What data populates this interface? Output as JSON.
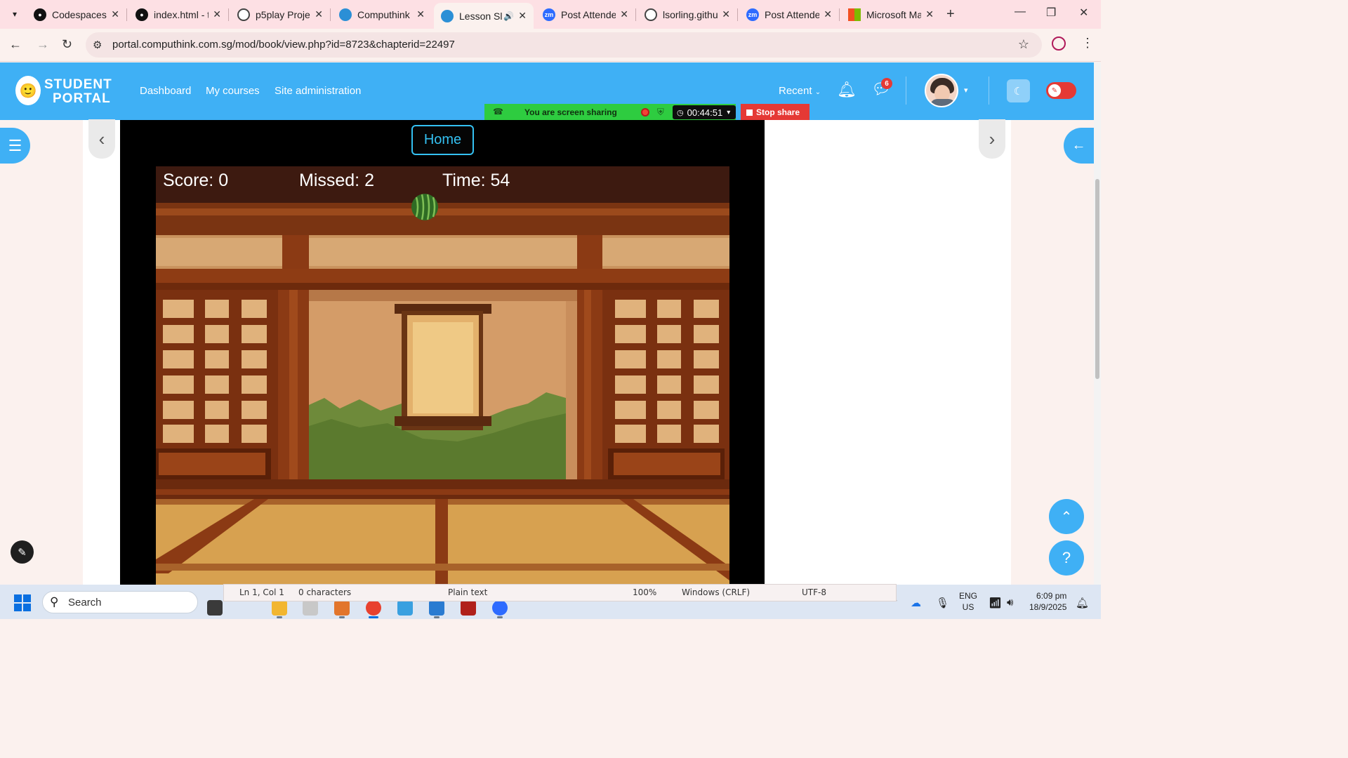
{
  "browser": {
    "tabs": [
      {
        "label": "Codespaces",
        "icon": "github-icon",
        "active": false
      },
      {
        "label": "index.html - t",
        "icon": "github-icon",
        "active": false
      },
      {
        "label": "p5play Projec",
        "icon": "globe-icon",
        "active": false
      },
      {
        "label": "Computhink",
        "icon": "computhink-icon",
        "active": false
      },
      {
        "label": "Lesson Sl",
        "icon": "computhink-icon",
        "active": true,
        "audio": true
      },
      {
        "label": "Post Attende",
        "icon": "zoom-icon",
        "active": false
      },
      {
        "label": "lsorling.githu",
        "icon": "globe-icon",
        "active": false
      },
      {
        "label": "Post Attende",
        "icon": "zoom-icon",
        "active": false
      },
      {
        "label": "Microsoft Ma",
        "icon": "microsoft-icon",
        "active": false
      }
    ],
    "url": "portal.computhink.com.sg/mod/book/view.php?id=8723&chapterid=22497"
  },
  "portal": {
    "logo_line1": "STUDENT",
    "logo_line2": "PORTAL",
    "nav": [
      "Dashboard",
      "My courses",
      "Site administration"
    ],
    "recent_label": "Recent",
    "message_count": "6"
  },
  "screen_share": {
    "status_text": "You are screen sharing",
    "timer": "00:44:51",
    "stop_label": "Stop share"
  },
  "game": {
    "home_label": "Home",
    "score_text": "Score: 0",
    "missed_text": "Missed: 2",
    "time_text": "Time: 54"
  },
  "notepad_status": {
    "position": "Ln 1, Col 1",
    "chars": "0 characters",
    "format": "Plain text",
    "zoom": "100%",
    "line_endings": "Windows (CRLF)",
    "encoding": "UTF-8"
  },
  "taskbar": {
    "search_placeholder": "Search",
    "lang_line1": "ENG",
    "lang_line2": "US",
    "time": "6:09 pm",
    "date": "18/9/2025"
  },
  "colors": {
    "portal_blue": "#3fb0f5",
    "share_green": "#2ecc40",
    "stop_red": "#e53935"
  }
}
